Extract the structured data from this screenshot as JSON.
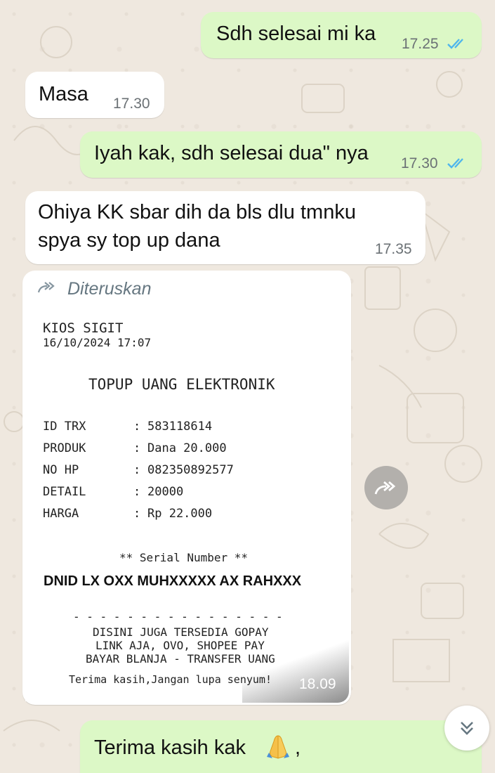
{
  "messages": [
    {
      "direction": "outgoing",
      "text": "Sdh selesai mi ka",
      "time": "17.25",
      "status": "read"
    },
    {
      "direction": "incoming",
      "text": "Masa",
      "time": "17.30"
    },
    {
      "direction": "outgoing",
      "text": "Iyah kak, sdh selesai dua\" nya",
      "time": "17.30",
      "status": "read"
    },
    {
      "direction": "incoming",
      "lines": [
        "Ohiya KK sbar dih da bls dlu tmnku",
        "spya sy top up dana"
      ],
      "time": "17.35"
    },
    {
      "direction": "incoming",
      "forwarded_label": "Diteruskan",
      "time": "18.09",
      "type": "image"
    },
    {
      "direction": "outgoing",
      "text": "Terima kasih kak",
      "emoji": "folded-hands",
      "trailing": ","
    }
  ],
  "receipt": {
    "store": "KIOS SIGIT",
    "datetime": "16/10/2024 17:07",
    "title": "TOPUP UANG ELEKTRONIK",
    "rows": [
      {
        "label": "ID TRX",
        "value": "583118614"
      },
      {
        "label": "PRODUK",
        "value": "Dana 20.000"
      },
      {
        "label": "NO HP",
        "value": "082350892577"
      },
      {
        "label": "DETAIL",
        "value": "20000"
      },
      {
        "label": "HARGA",
        "value": "Rp 22.000"
      }
    ],
    "serial_heading": "** Serial Number **",
    "serial_value": "DNID LX OXX MUHXXXXX AX RAHXXX",
    "divider": "- - - - - - - - - - - - - - - -",
    "footer_lines": [
      "DISINI JUGA TERSEDIA GOPAY",
      "LINK AJA, OVO, SHOPEE PAY",
      "BAYAR BLANJA - TRANSFER UANG"
    ],
    "thanks": "Terima kasih,Jangan lupa senyum!"
  },
  "colors": {
    "outgoing_bubble": "#dcf8c6",
    "incoming_bubble": "#ffffff",
    "read_ticks": "#4fb6ec",
    "wallpaper": "#efe8df"
  },
  "icons": {
    "read_status": "double-check-icon",
    "forwarded": "forward-arrows-icon",
    "forward_button": "forward-arrows-icon",
    "scroll_down": "chevron-double-down-icon"
  }
}
